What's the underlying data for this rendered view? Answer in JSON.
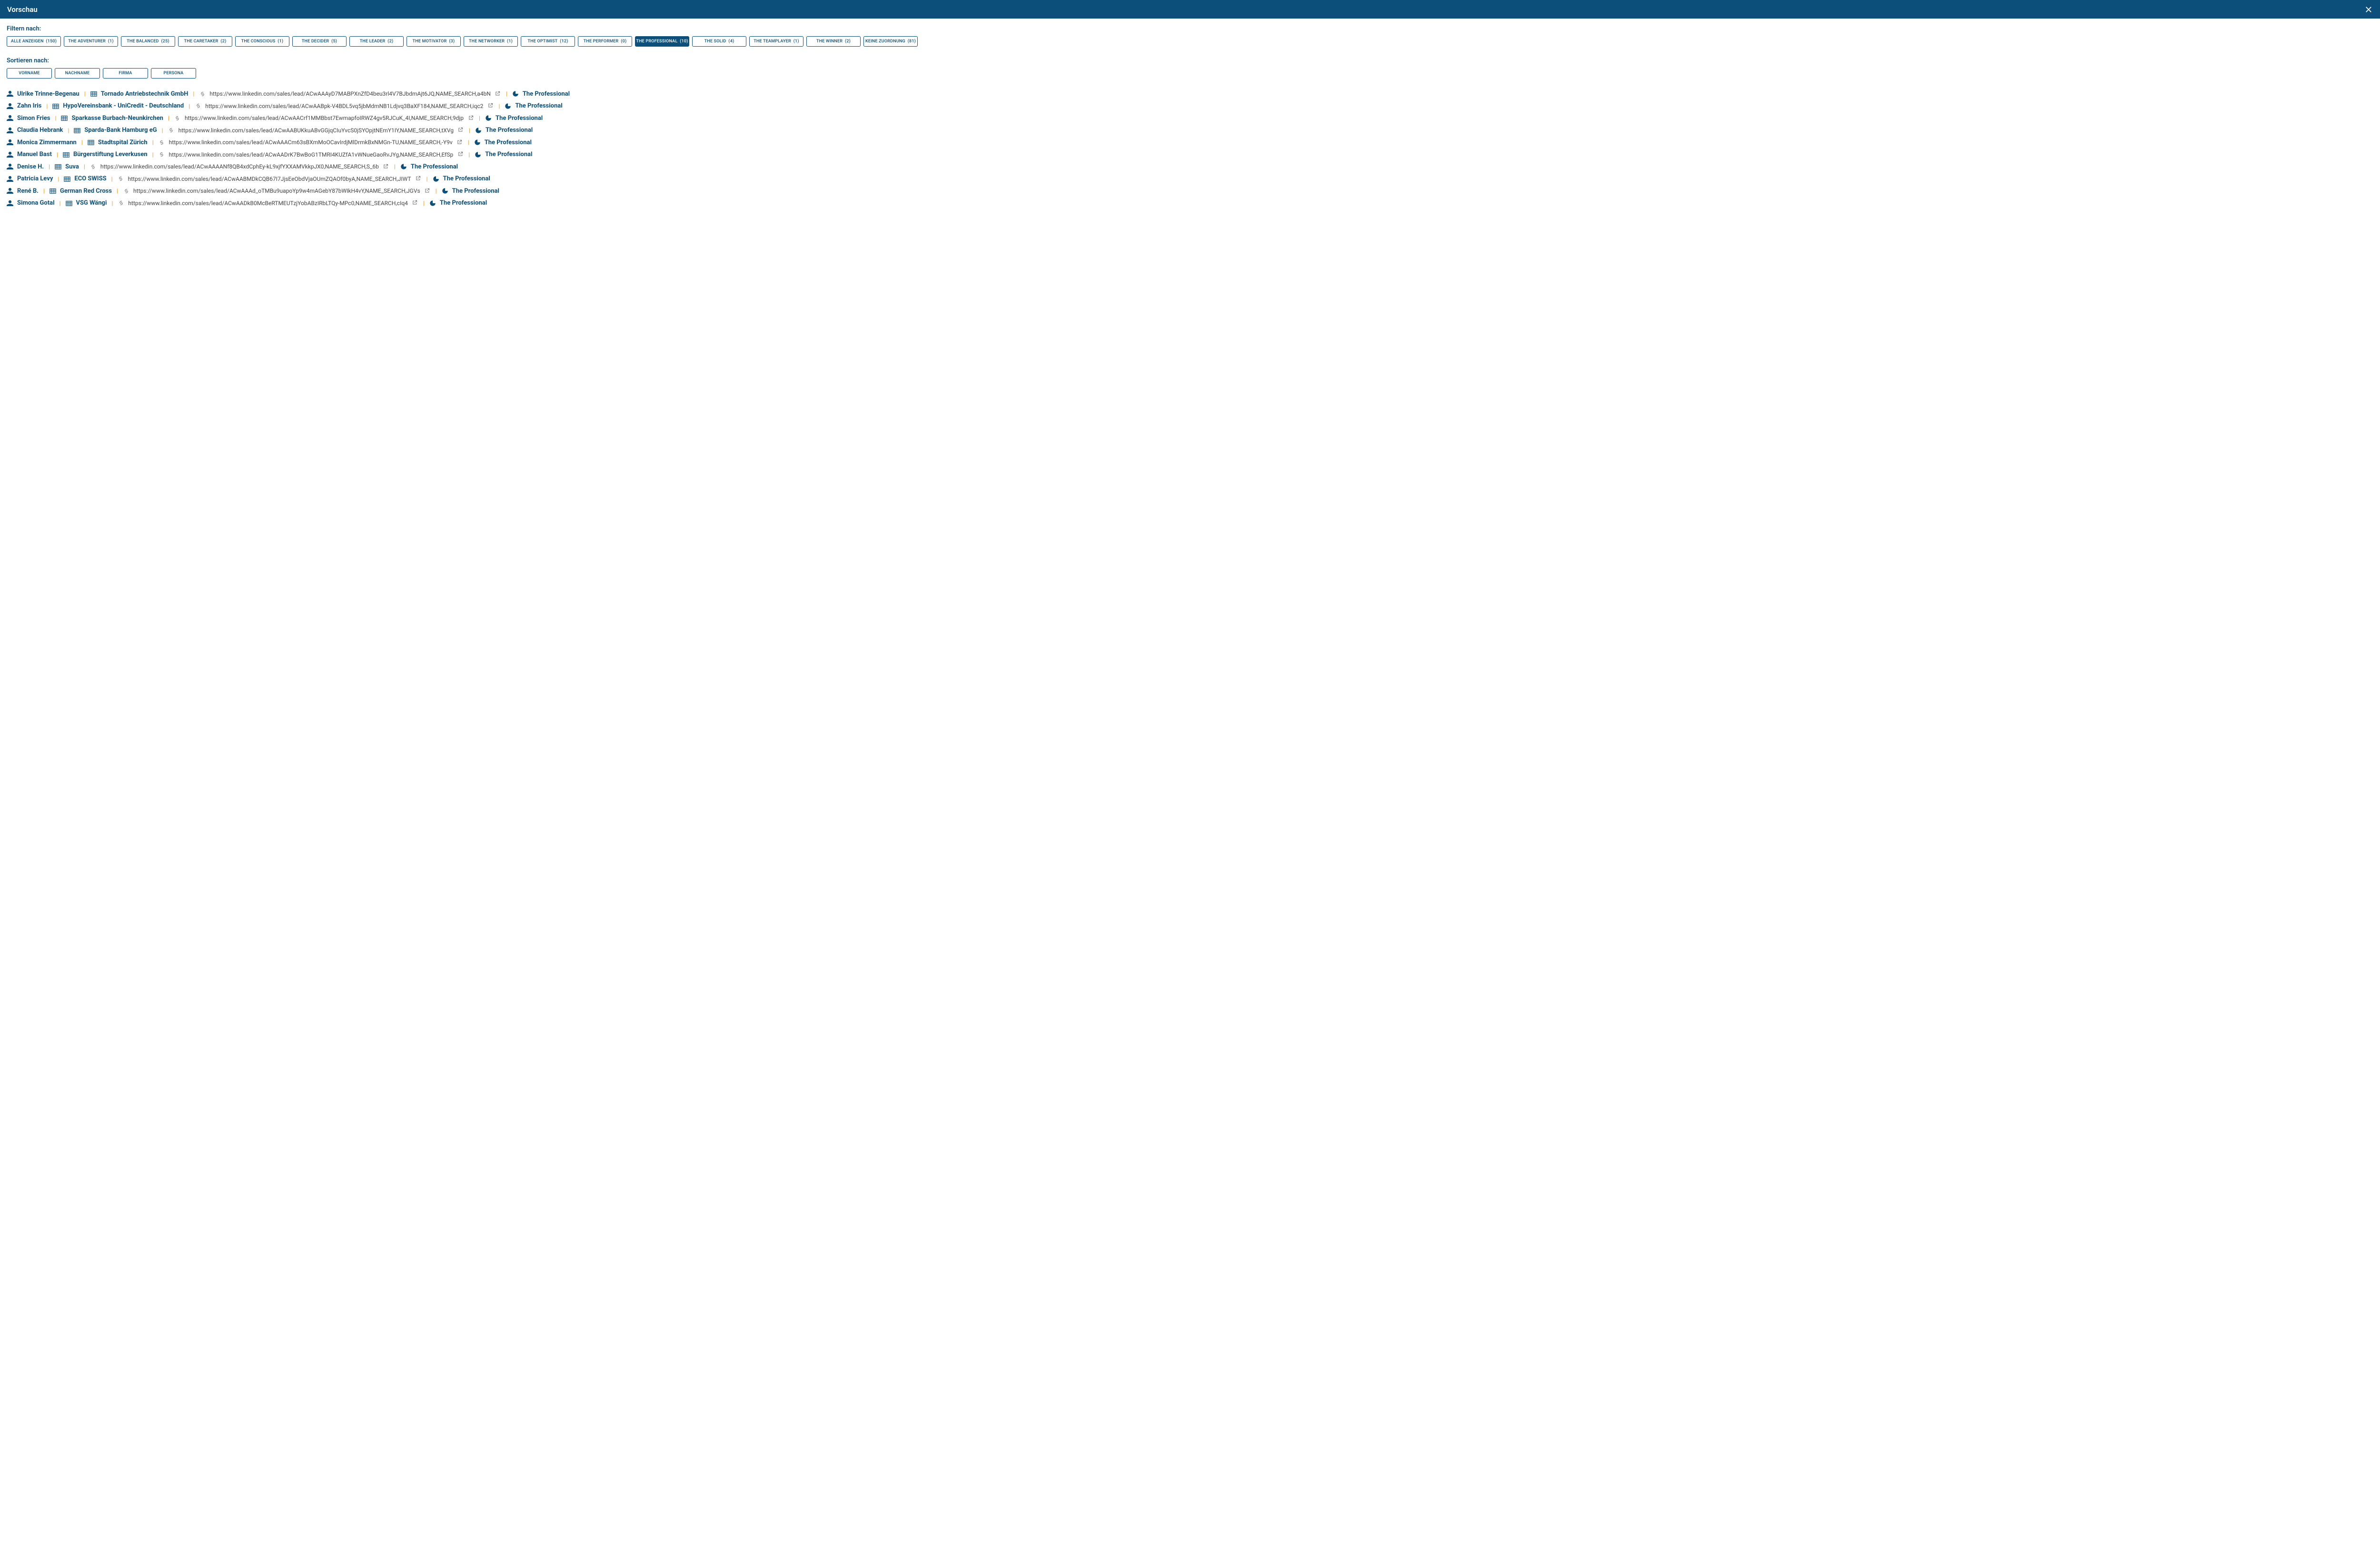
{
  "header": {
    "title": "Vorschau"
  },
  "filter": {
    "label": "Filtern nach:",
    "items": [
      {
        "label": "ALLE ANZEIGEN",
        "count": 150,
        "active": false
      },
      {
        "label": "THE ADVENTURER",
        "count": 1,
        "active": false
      },
      {
        "label": "THE BALANCED",
        "count": 25,
        "active": false
      },
      {
        "label": "THE CARETAKER",
        "count": 2,
        "active": false
      },
      {
        "label": "THE CONSCIOUS",
        "count": 1,
        "active": false
      },
      {
        "label": "THE DECIDER",
        "count": 5,
        "active": false
      },
      {
        "label": "THE LEADER",
        "count": 2,
        "active": false
      },
      {
        "label": "THE MOTIVATOR",
        "count": 3,
        "active": false
      },
      {
        "label": "THE NETWORKER",
        "count": 1,
        "active": false
      },
      {
        "label": "THE OPTIMIST",
        "count": 12,
        "active": false
      },
      {
        "label": "THE PERFORMER",
        "count": 0,
        "active": false
      },
      {
        "label": "THE PROFESSIONAL",
        "count": 10,
        "active": true
      },
      {
        "label": "THE SOLID",
        "count": 4,
        "active": false
      },
      {
        "label": "THE TEAMPLAYER",
        "count": 1,
        "active": false
      },
      {
        "label": "THE WINNER",
        "count": 2,
        "active": false
      },
      {
        "label": "KEINE ZUORDNUNG",
        "count": 81,
        "active": false
      }
    ]
  },
  "sort": {
    "label": "Sortieren nach:",
    "items": [
      {
        "label": "VORNAME"
      },
      {
        "label": "NACHNAME"
      },
      {
        "label": "FIRMA"
      },
      {
        "label": "PERSONA"
      }
    ]
  },
  "separator": "|",
  "rows": [
    {
      "name": "Ulrike Trinne-Begenau",
      "company": "Tornado Antriebstechnik GmbH",
      "url": "https://www.linkedin.com/sales/lead/ACwAAAyD7MABPXnZfD4beu3rl4V7BJbdmAjt6JQ,NAME_SEARCH,a4bN",
      "persona": "The Professional"
    },
    {
      "name": "Zahn Iris",
      "company": "HypoVereinsbank - UniCredit - Deutschland",
      "url": "https://www.linkedin.com/sales/lead/ACwAABpk-V4BDL5vq5jbMdmNB1Ldjvq3BaXF184,NAME_SEARCH,iqc2",
      "persona": "The Professional"
    },
    {
      "name": "Simon Fries",
      "company": "Sparkasse Burbach-Neunkirchen",
      "url": "https://www.linkedin.com/sales/lead/ACwAACrf1MMBbst7EwmapfoIRWZ4gv5RJCuK_4I,NAME_SEARCH,9djp",
      "persona": "The Professional"
    },
    {
      "name": "Claudia Hebrank",
      "company": "Sparda-Bank Hamburg eG",
      "url": "https://www.linkedin.com/sales/lead/ACwAABUKkuABvGGjqCIuYvcS0jSYOpjtNEmY1IY,NAME_SEARCH,tXVg",
      "persona": "The Professional"
    },
    {
      "name": "Monica Zimmermann",
      "company": "Stadtspital Zürich",
      "url": "https://www.linkedin.com/sales/lead/ACwAAACm63sBXmMoOCavIrdjMlDrmkBxNMGn-TU,NAME_SEARCH,-Y9v",
      "persona": "The Professional"
    },
    {
      "name": "Manuel Bast",
      "company": "Bürgerstiftung Leverkusen",
      "url": "https://www.linkedin.com/sales/lead/ACwAADrK7BwBoG1TMRI4KUZfA1vWNueGaoRvJYg,NAME_SEARCH,EfSp",
      "persona": "The Professional"
    },
    {
      "name": "Denise H.",
      "company": "Suva",
      "url": "https://www.linkedin.com/sales/lead/ACwAAAANf8QB4xdCphEy-kL9xjfYXXAMVkkpJX0,NAME_SEARCH,S_6b",
      "persona": "The Professional"
    },
    {
      "name": "Patricia Levy",
      "company": "ECO SWISS",
      "url": "https://www.linkedin.com/sales/lead/ACwAABMDkCQB67I7JjsEeObdVjaOUmZQAOf0byA,NAME_SEARCH,JIWT",
      "persona": "The Professional"
    },
    {
      "name": "René B.",
      "company": "German Red Cross",
      "url": "https://www.linkedin.com/sales/lead/ACwAAAd_oTMBu9uapoYp9w4mAGebY87bWIkH4vY,NAME_SEARCH,JGVs",
      "persona": "The Professional"
    },
    {
      "name": "Simona Gotal",
      "company": "VSG Wängi",
      "url": "https://www.linkedin.com/sales/lead/ACwAADkB0McBeRTMEUTzjYobABzIRbLTQy-MPc0,NAME_SEARCH,cIq4",
      "persona": "The Professional"
    }
  ]
}
